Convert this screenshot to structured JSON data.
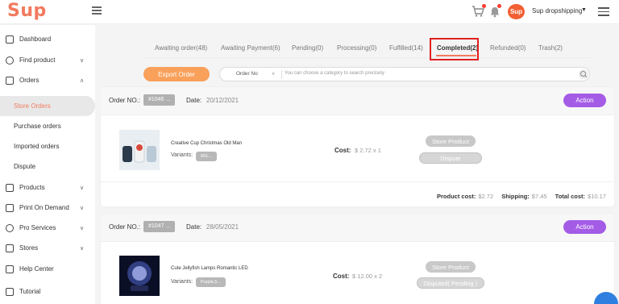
{
  "brand": {
    "logo": "Sup",
    "accent": "#f27a5e"
  },
  "topbar": {
    "avatar_text": "Sup",
    "user_name": "Sup dropshipping",
    "user_caret": "▼",
    "icons": [
      "menu-icon",
      "cart-icon",
      "bell-icon",
      "avatar",
      "hamburger-menu-icon"
    ]
  },
  "sidebar": {
    "items": [
      {
        "label": "Dashboard",
        "icon": "dashboard-icon",
        "has_chevron": false
      },
      {
        "label": "Find product",
        "icon": "search-product-icon",
        "has_chevron": true
      },
      {
        "label": "Orders",
        "icon": "orders-icon",
        "has_chevron": true,
        "expanded": true
      },
      {
        "label": "Products",
        "icon": "products-icon",
        "has_chevron": true
      },
      {
        "label": "Print On Demand",
        "icon": "print-icon",
        "has_chevron": true
      },
      {
        "label": "Pro Services",
        "icon": "pro-services-icon",
        "has_chevron": true
      },
      {
        "label": "Stores",
        "icon": "stores-icon",
        "has_chevron": true
      },
      {
        "label": "Help Center",
        "icon": "help-icon",
        "has_chevron": false
      },
      {
        "label": "Tutorial",
        "icon": "tutorial-icon",
        "has_chevron": false
      }
    ],
    "orders_sub": [
      {
        "label": "Store Orders",
        "active": true
      },
      {
        "label": "Purchase orders",
        "active": false
      },
      {
        "label": "Imported orders",
        "active": false
      },
      {
        "label": "Dispute",
        "active": false
      }
    ],
    "chevron_down": "∨",
    "chevron_up": "∧"
  },
  "tabs": [
    {
      "label": "Awaiting order(48)",
      "active": false
    },
    {
      "label": "Awaiting Payment(6)",
      "active": false
    },
    {
      "label": "Pending(0)",
      "active": false
    },
    {
      "label": "Processing(0)",
      "active": false
    },
    {
      "label": "Fulfilled(14)",
      "active": false
    },
    {
      "label": "Completed(2)",
      "active": true
    },
    {
      "label": "Refunded(0)",
      "active": false
    },
    {
      "label": "Trash(2)",
      "active": false
    }
  ],
  "filters": {
    "export_label": "Export Order",
    "search_category": "Order No",
    "search_caret": "∨",
    "search_placeholder": "You can choose a category to search precisely"
  },
  "orders": [
    {
      "order_label": "Order NO.:",
      "order_no": "#1046 ...",
      "date_label": "Date:",
      "date": "20/12/2021",
      "action_label": "Action",
      "product_name": "Creative Cup Christmas Old Man",
      "variants_label": "Variants:",
      "variant": "601...",
      "cost_label": "Cost:",
      "cost": "$ 2.72 x 1",
      "primary_btn": "Store Product",
      "secondary_btn": "Dispute",
      "product_cost_label": "Product cost:",
      "product_cost": "$2.72",
      "shipping_label": "Shipping:",
      "shipping": "$7.45",
      "total_label": "Total cost:",
      "total": "$10.17"
    },
    {
      "order_label": "Order NO.:",
      "order_no": "#1047 ...",
      "date_label": "Date:",
      "date": "28/05/2021",
      "action_label": "Action",
      "product_name": "Cute Jellyfish Lamps Romantic LED",
      "variants_label": "Variants:",
      "variant": "Purple,5...",
      "cost_label": "Cost:",
      "cost": "$ 12.00 x 2",
      "primary_btn": "Store Product",
      "secondary_btn": "Disputed( Pending )"
    }
  ]
}
